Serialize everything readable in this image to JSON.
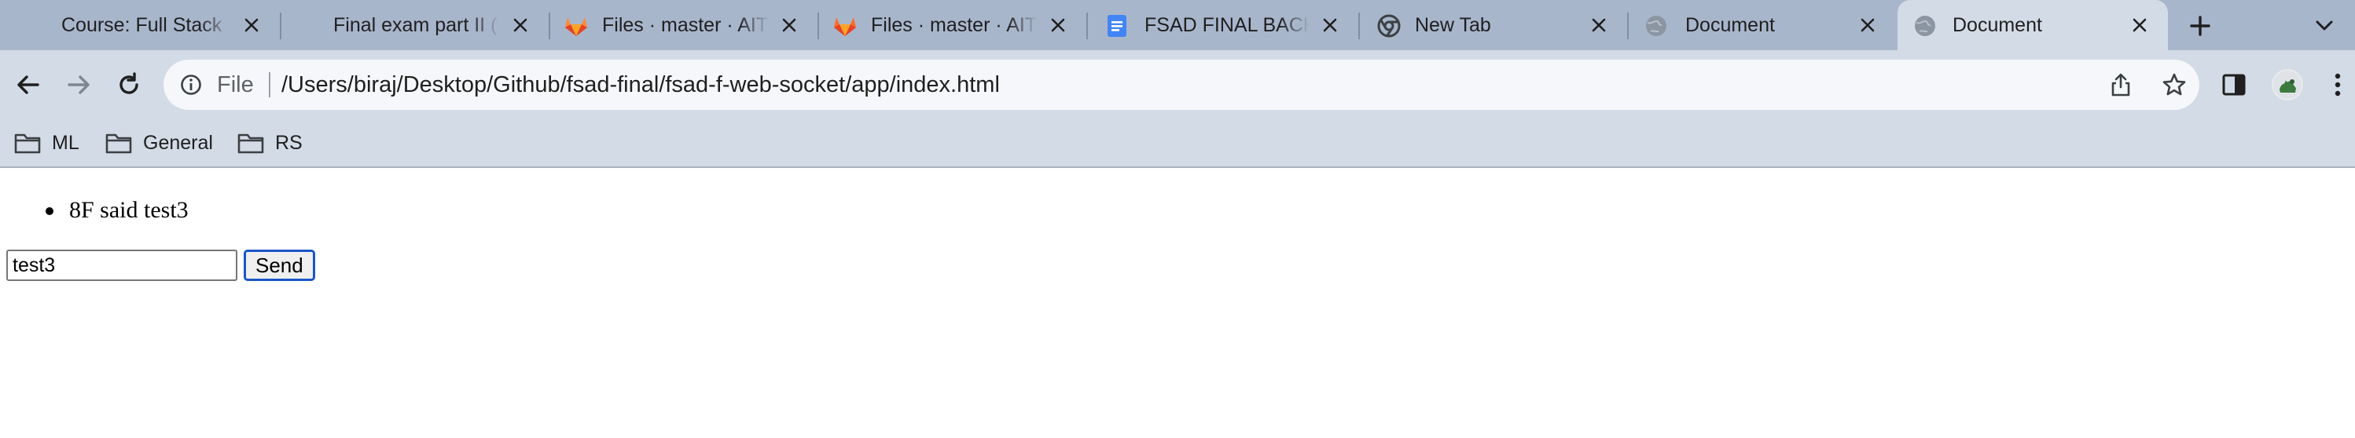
{
  "tabs": [
    {
      "title": "Course: Full Stack",
      "icon": "none",
      "active": false
    },
    {
      "title": "Final exam part II (",
      "icon": "none",
      "active": false
    },
    {
      "title": "Files · master · AIT",
      "icon": "gitlab-icon",
      "active": false
    },
    {
      "title": "Files · master · AIT",
      "icon": "gitlab-icon",
      "active": false
    },
    {
      "title": "FSAD FINAL BACK",
      "icon": "docs-icon",
      "active": false
    },
    {
      "title": "New Tab",
      "icon": "chrome-icon",
      "active": false
    },
    {
      "title": "Document",
      "icon": "globe-icon",
      "active": false
    },
    {
      "title": "Document",
      "icon": "globe-icon",
      "active": true
    }
  ],
  "toolbar": {
    "scheme_label": "File",
    "url": "/Users/biraj/Desktop/Github/fsad-final/fsad-f-web-socket/app/index.html"
  },
  "bookmarks": [
    {
      "label": "ML"
    },
    {
      "label": "General"
    },
    {
      "label": "RS"
    }
  ],
  "page": {
    "messages": [
      "8F said test3"
    ],
    "input_value": "test3",
    "send_label": "Send"
  },
  "colors": {
    "tabstrip": "#a8b6cc",
    "toolbar": "#d3dbe6",
    "gitlab_orange": "#e2432a",
    "docs_blue": "#4285f4",
    "send_border": "#1a56c8"
  }
}
